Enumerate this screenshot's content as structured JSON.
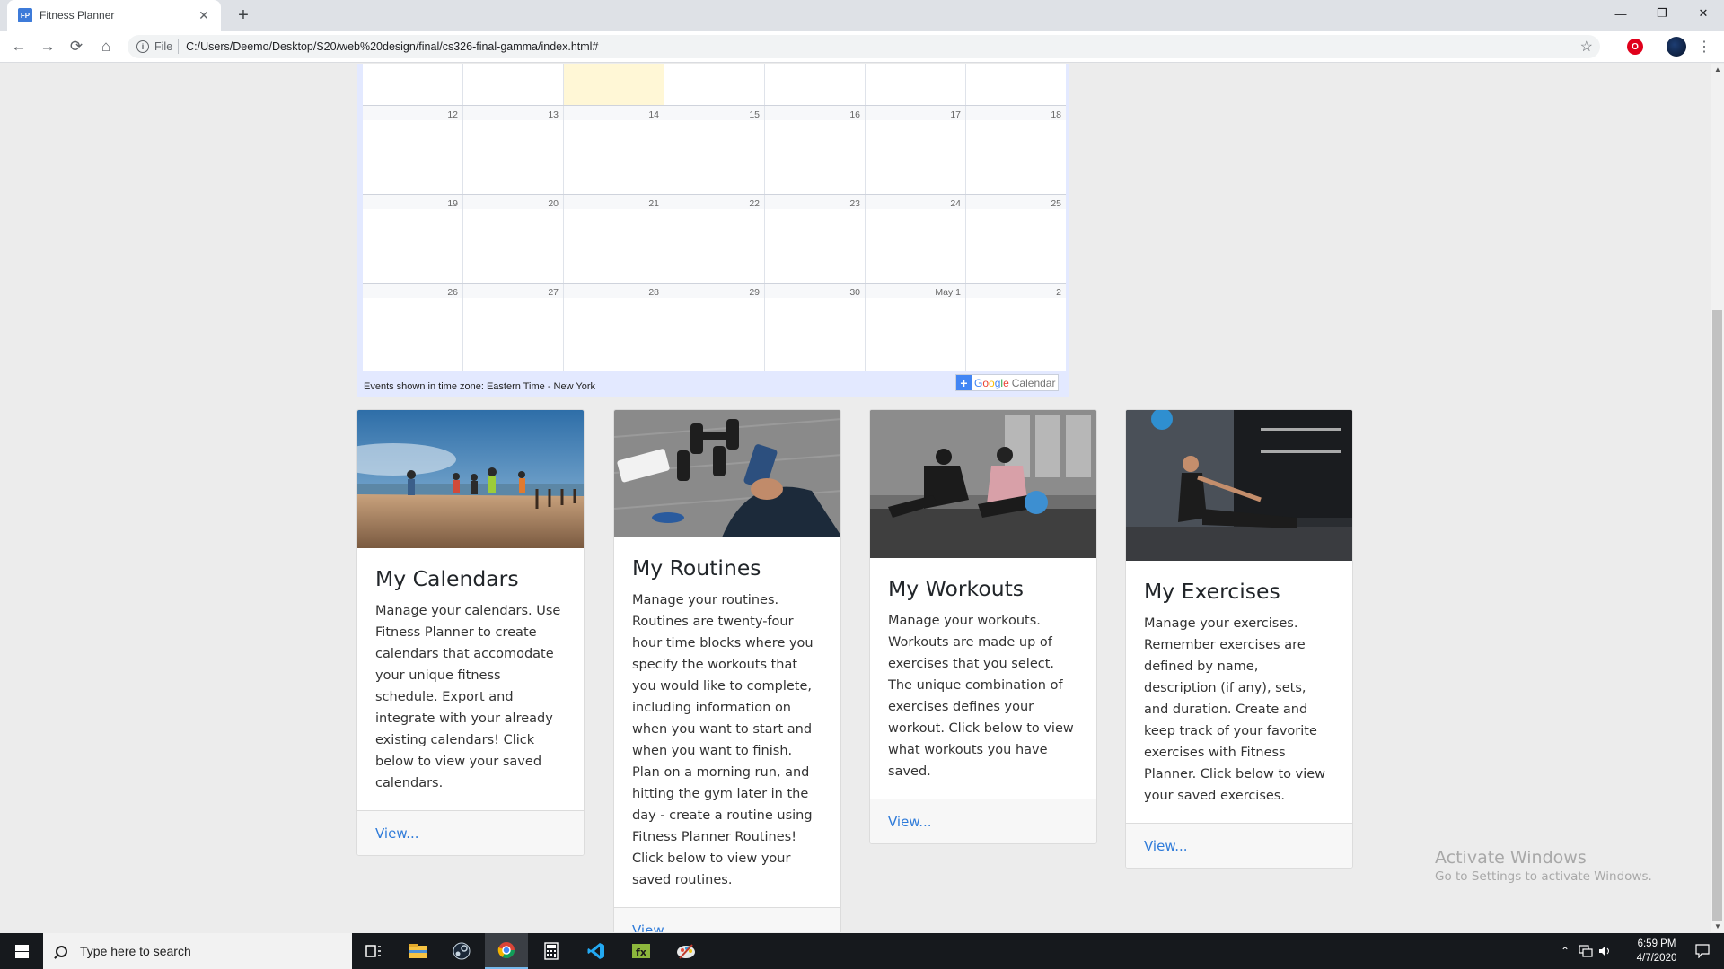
{
  "browser": {
    "tab_title": "Fitness Planner",
    "tab_favicon": "FP",
    "new_tab_label": "+",
    "url_scheme_label": "File",
    "url": "C:/Users/Deemo/Desktop/S20/web%20design/final/cs326-final-gamma/index.html#"
  },
  "calendar": {
    "weeks": [
      [
        "",
        "",
        "",
        "",
        "",
        "",
        ""
      ],
      [
        "12",
        "13",
        "14",
        "15",
        "16",
        "17",
        "18"
      ],
      [
        "19",
        "20",
        "21",
        "22",
        "23",
        "24",
        "25"
      ],
      [
        "26",
        "27",
        "28",
        "29",
        "30",
        "May 1",
        "2"
      ]
    ],
    "today_index": [
      0,
      2
    ],
    "timezone_text": "Events shown in time zone: Eastern Time - New York",
    "badge_plus": "+",
    "badge_google": [
      "G",
      "o",
      "o",
      "g",
      "l",
      "e"
    ],
    "badge_word": "Calendar"
  },
  "cards": [
    {
      "title": "My Calendars",
      "text": "Manage your calendars. Use Fitness Planner to create calendars that accomodate your unique fitness schedule. Export and integrate with your already existing calendars! Click below to view your saved calendars.",
      "link": "View...",
      "image": "runners-on-boardwalk"
    },
    {
      "title": "My Routines",
      "text": "Manage your routines. Routines are twenty-four hour time blocks where you specify the workouts that you would like to complete, including information on when you want to start and when you want to finish. Plan on a morning run, and hitting the gym later in the day - create a routine using Fitness Planner Routines! Click below to view your saved routines.",
      "link": "View...",
      "image": "phone-and-dumbbells"
    },
    {
      "title": "My Workouts",
      "text": "Manage your workouts. Workouts are made up of exercises that you select. The unique combination of exercises defines your workout. Click below to view what workouts you have saved.",
      "link": "View...",
      "image": "couple-ab-workout"
    },
    {
      "title": "My Exercises",
      "text": "Manage your exercises. Remember exercises are defined by name, description (if any), sets, and duration. Create and keep track of your favorite exercises with Fitness Planner. Click below to view your saved exercises.",
      "link": "View...",
      "image": "gym-stretching"
    }
  ],
  "watermark": {
    "line1": "Activate Windows",
    "line2": "Go to Settings to activate Windows."
  },
  "taskbar": {
    "search_placeholder": "Type here to search",
    "time": "6:59 PM",
    "date": "4/7/2020"
  },
  "colors": {
    "accent_link": "#2f7bd9",
    "today_highlight": "#fff7d6",
    "calendar_frame": "#e3e9ff"
  }
}
